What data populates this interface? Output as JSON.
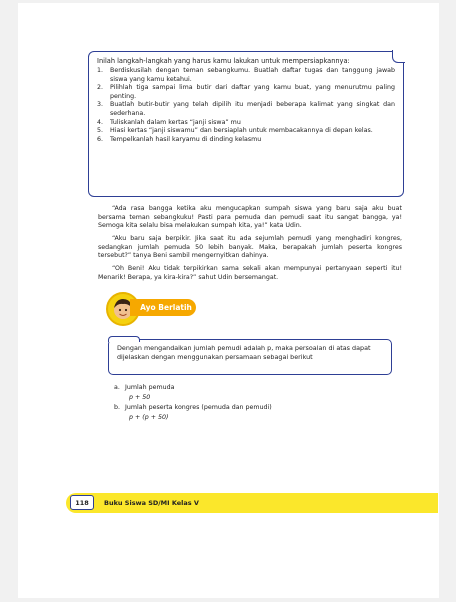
{
  "box": {
    "intro": "Inilah langkah-langkah yang harus kamu lakukan untuk mempersiapkannya:",
    "steps": [
      {
        "num": "1.",
        "text": "Berdiskusilah dengan teman sebangkumu. Buatlah daftar tugas dan tanggung jawab siswa yang kamu ketahui."
      },
      {
        "num": "2.",
        "text": "Pilihlah tiga sampai lima butir dari daftar yang kamu buat, yang menurutmu paling penting."
      },
      {
        "num": "3.",
        "text": "Buatlah butir-butir yang telah dipilih itu menjadi beberapa kalimat yang singkat dan sederhana."
      },
      {
        "num": "4.",
        "text": "Tuliskanlah dalam kertas “janji siswa” mu"
      },
      {
        "num": "5.",
        "text": "Hiasi kertas “janji siswamu” dan bersiaplah untuk membacakannya di depan kelas."
      },
      {
        "num": "6.",
        "text": "Tempelkanlah hasil karyamu di dinding kelasmu"
      }
    ]
  },
  "paragraphs": [
    "“Ada rasa bangga ketika aku mengucapkan sumpah siswa yang baru saja aku buat bersama teman sebangkuku! Pasti para pemuda dan pemudi saat itu sangat bangga, ya! Semoga kita selalu bisa melakukan sumpah kita, ya!” kata Udin.",
    "“Aku baru saja berpikir. Jika saat itu ada sejumlah pemudi yang menghadiri kongres, sedangkan jumlah pemuda 50 lebih banyak. Maka, berapakah jumlah peserta kongres tersebut?” tanya Beni sambil mengernyitkan dahinya.",
    "“Oh Beni! Aku tidak terpikirkan sama sekali akan mempunyai pertanyaan seperti itu! Menarik! Berapa, ya kira-kira?” sahut Udin bersemangat."
  ],
  "badge": {
    "label": "Ayo Berlatih"
  },
  "exercise": {
    "text": "Dengan mengandaikan jumlah pemudi adalah p, maka persoalan di atas dapat dijelaskan dengan menggunakan persamaan sebagai berikut"
  },
  "answers": [
    {
      "label": "a.",
      "title": "Jumlah pemuda",
      "expr": "p + 50"
    },
    {
      "label": "b.",
      "title": "Jumlah peserta kongres (pemuda dan pemudi)",
      "expr": "p + (p + 50)"
    }
  ],
  "footer": {
    "page": "118",
    "title": "Buku Siswa SD/MI Kelas V"
  },
  "colors": {
    "accent": "#2e3f95",
    "badge": "#f6a800",
    "footer": "#fbe72b"
  }
}
